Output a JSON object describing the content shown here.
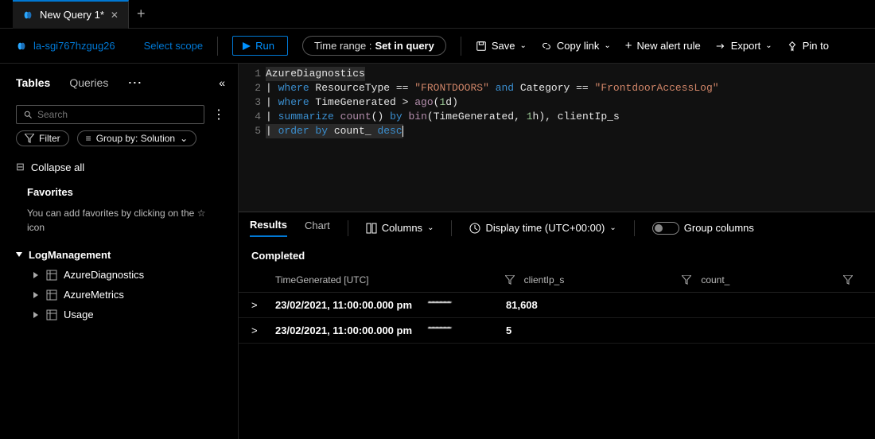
{
  "tabs": {
    "title": "New Query 1*"
  },
  "workspace": {
    "name": "la-sgi767hzgug26",
    "scope_link": "Select scope"
  },
  "toolbar": {
    "run": "Run",
    "time_label": "Time range :",
    "time_value": "Set in query",
    "save": "Save",
    "copy": "Copy link",
    "alert": "New alert rule",
    "export": "Export",
    "pin": "Pin to"
  },
  "sidebar": {
    "tabs": {
      "tables": "Tables",
      "queries": "Queries"
    },
    "search_placeholder": "Search",
    "filter_label": "Filter",
    "groupby_label": "Group by: Solution",
    "collapse": "Collapse all",
    "fav_head": "Favorites",
    "fav_desc": "You can add favorites by clicking on the ☆ icon",
    "group": "LogManagement",
    "leaves": [
      "AzureDiagnostics",
      "AzureMetrics",
      "Usage"
    ]
  },
  "editor": {
    "lines": [
      1,
      2,
      3,
      4,
      5
    ],
    "source_plain": "AzureDiagnostics\n| where ResourceType == \"FRONTDOORS\" and Category == \"FrontdoorAccessLog\"\n| where TimeGenerated > ago(1d)\n| summarize count() by bin(TimeGenerated, 1h), clientIp_s\n| order by count_ desc"
  },
  "results": {
    "tabs": {
      "results": "Results",
      "chart": "Chart"
    },
    "columns_btn": "Columns",
    "display_time": "Display time (UTC+00:00)",
    "group_cols": "Group columns",
    "status": "Completed",
    "headers": {
      "c1": "TimeGenerated [UTC]",
      "c2": "clientIp_s",
      "c3": "count_"
    },
    "rows": [
      {
        "time": "23/02/2021, 11:00:00.000 pm",
        "ip": "(redacted)",
        "count": "81,608"
      },
      {
        "time": "23/02/2021, 11:00:00.000 pm",
        "ip": "(redacted)",
        "count": "5"
      }
    ]
  }
}
